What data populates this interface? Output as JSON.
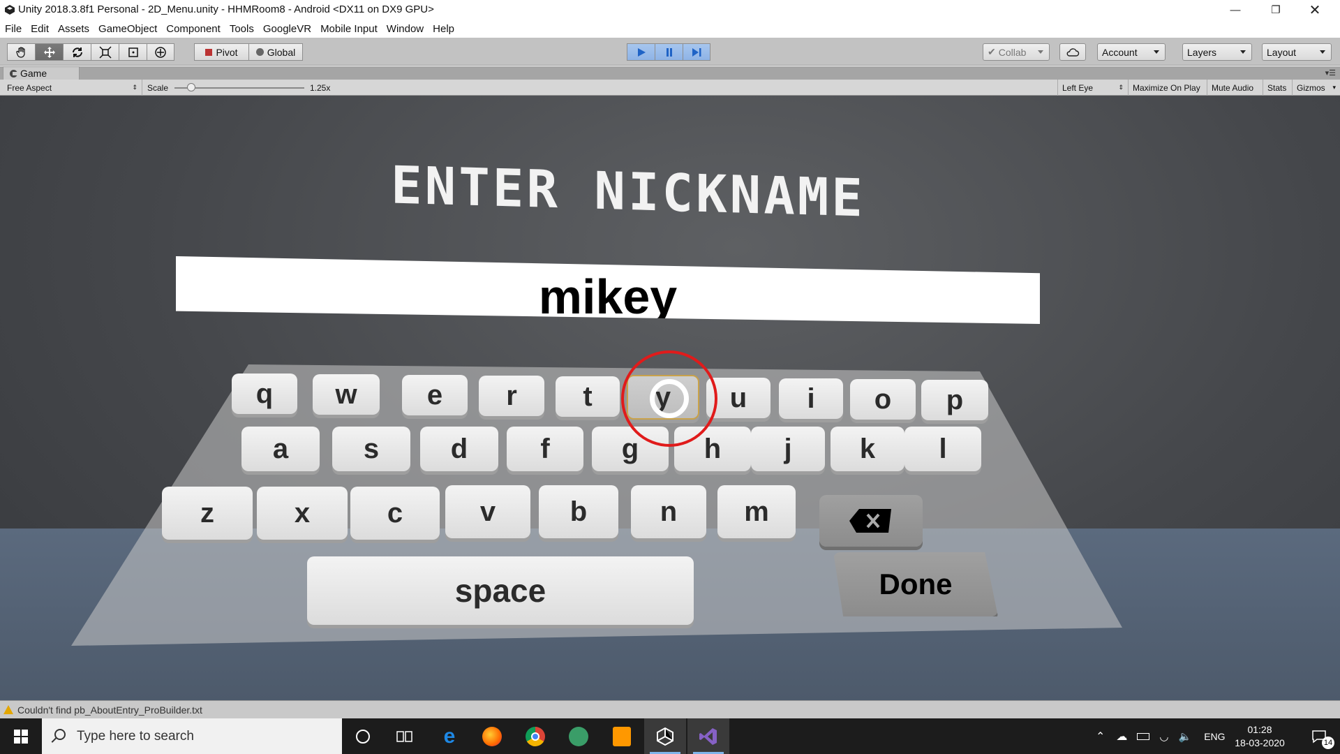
{
  "window": {
    "title": "Unity 2018.3.8f1 Personal - 2D_Menu.unity - HHMRoom8 - Android <DX11 on DX9 GPU>",
    "controls": [
      "minimize",
      "restore",
      "close"
    ]
  },
  "menu": [
    "File",
    "Edit",
    "Assets",
    "GameObject",
    "Component",
    "Tools",
    "GoogleVR",
    "Mobile Input",
    "Window",
    "Help"
  ],
  "toolbar": {
    "pivot_label": "Pivot",
    "global_label": "Global",
    "collab_label": "Collab",
    "account_label": "Account",
    "layers_label": "Layers",
    "layout_label": "Layout"
  },
  "game_tab": {
    "label": "Game",
    "aspect": "Free Aspect",
    "scale_label": "Scale",
    "scale_value": "1.25x",
    "eye": "Left Eye",
    "maximize_on_play": "Maximize On Play",
    "mute_audio": "Mute Audio",
    "stats": "Stats",
    "gizmos": "Gizmos"
  },
  "scene": {
    "heading": "ENTER NICKNAME",
    "nickname_value": "mikey",
    "keys_row1": [
      "q",
      "w",
      "e",
      "r",
      "t",
      "y",
      "u",
      "i",
      "o",
      "p"
    ],
    "keys_row2": [
      "a",
      "s",
      "d",
      "f",
      "g",
      "h",
      "j",
      "k",
      "l"
    ],
    "keys_row3": [
      "z",
      "x",
      "c",
      "v",
      "b",
      "n",
      "m"
    ],
    "space_label": "space",
    "done_label": "Done",
    "highlighted_key": "y"
  },
  "status": {
    "message": "Couldn't find pb_AboutEntry_ProBuilder.txt"
  },
  "taskbar": {
    "search_placeholder": "Type here to search",
    "language": "ENG",
    "time": "01:28",
    "date": "18-03-2020",
    "notification_count": "14"
  }
}
